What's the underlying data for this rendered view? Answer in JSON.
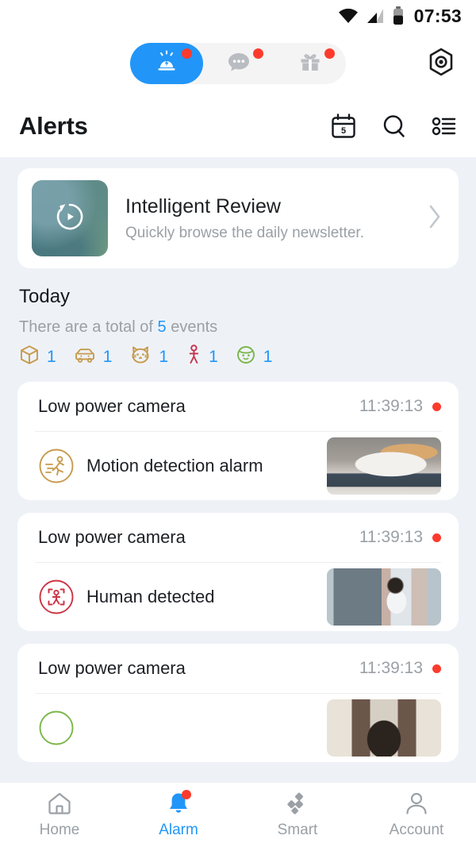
{
  "status_bar": {
    "time": "07:53",
    "icons": [
      "wifi-icon",
      "cellular-signal-icon",
      "battery-icon"
    ],
    "battery_level_pct": 55
  },
  "top_segment": {
    "items": [
      {
        "name": "alarm-siren-icon",
        "active": true,
        "badge": true
      },
      {
        "name": "message-bubble-icon",
        "active": false,
        "badge": true
      },
      {
        "name": "gift-icon",
        "active": false,
        "badge": true
      }
    ],
    "settings_icon": "hex-gear-icon",
    "active_color": "#2196f8",
    "track_color": "#f4f4f5",
    "badge_color": "#fc3b2d"
  },
  "header": {
    "title": "Alerts",
    "actions": [
      {
        "name": "calendar-icon",
        "label": "5"
      },
      {
        "name": "search-icon"
      },
      {
        "name": "filter-list-icon"
      }
    ]
  },
  "review_card": {
    "title": "Intelligent Review",
    "subtitle": "Quickly browse the daily newsletter.",
    "thumbnail": "replay-play-icon",
    "chevron": "chevron-right-icon"
  },
  "today": {
    "heading": "Today",
    "summary_prefix": "There are a total of ",
    "summary_count": "5",
    "summary_suffix": " events",
    "counts": [
      {
        "icon": "package-box-icon",
        "color": "#c79a4b",
        "value": "1"
      },
      {
        "icon": "car-icon",
        "color": "#c79a4b",
        "value": "1"
      },
      {
        "icon": "cat-face-icon",
        "color": "#c79a4b",
        "value": "1"
      },
      {
        "icon": "person-walk-icon",
        "color": "#c8304a",
        "value": "1"
      },
      {
        "icon": "baby-face-icon",
        "color": "#7ab648",
        "value": "1"
      }
    ],
    "count_text_color": "#2196f8"
  },
  "alerts": [
    {
      "device": "Low power camera",
      "time": "11:39:13",
      "unread": true,
      "event_type": "Motion detection alarm",
      "event_icon": "motion-run-circle-icon",
      "event_icon_color": "#c79a4b",
      "thumbnail": "cat-on-cushion-thumbnail"
    },
    {
      "device": "Low power camera",
      "time": "11:39:13",
      "unread": true,
      "event_type": "Human detected",
      "event_icon": "human-detect-circle-icon",
      "event_icon_color": "#cc3344",
      "thumbnail": "man-sitting-thumbnail"
    },
    {
      "device": "Low power camera",
      "time": "11:39:13",
      "unread": true,
      "event_type": "",
      "event_icon": "face-circle-icon",
      "event_icon_color": "#7ab648",
      "thumbnail": "face-thumbnail"
    }
  ],
  "bottom_nav": {
    "items": [
      {
        "label": "Home",
        "icon": "home-icon",
        "active": false,
        "badge": false
      },
      {
        "label": "Alarm",
        "icon": "bell-icon",
        "active": true,
        "badge": true
      },
      {
        "label": "Smart",
        "icon": "smart-diamonds-icon",
        "active": false,
        "badge": false
      },
      {
        "label": "Account",
        "icon": "person-icon",
        "active": false,
        "badge": false
      }
    ],
    "active_color": "#2196f8",
    "inactive_color": "#9aa0a6"
  }
}
